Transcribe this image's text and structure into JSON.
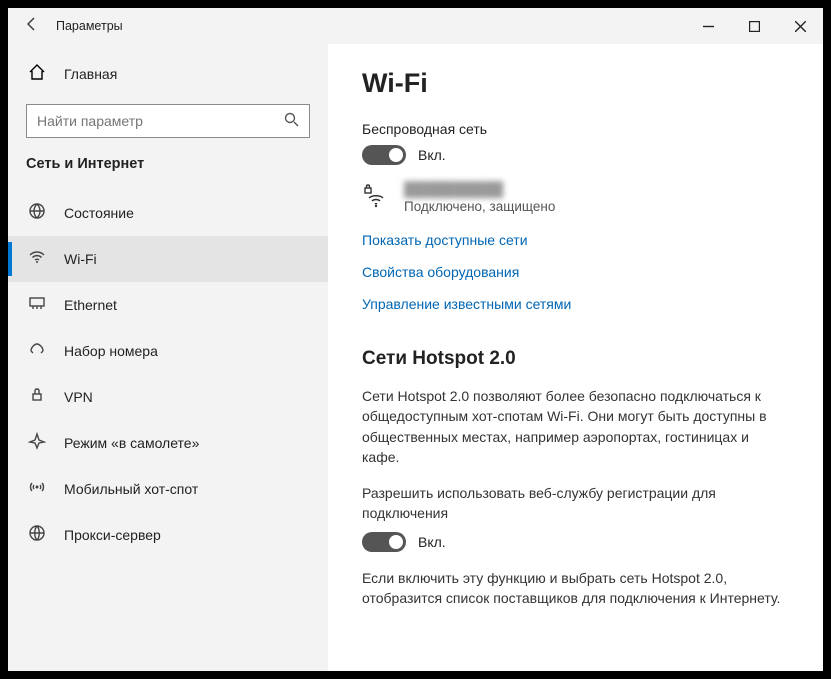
{
  "titlebar": {
    "title": "Параметры"
  },
  "sidebar": {
    "home_label": "Главная",
    "search_placeholder": "Найти параметр",
    "section_title": "Сеть и Интернет",
    "items": [
      {
        "label": "Состояние"
      },
      {
        "label": "Wi-Fi"
      },
      {
        "label": "Ethernet"
      },
      {
        "label": "Набор номера"
      },
      {
        "label": "VPN"
      },
      {
        "label": "Режим «в самолете»"
      },
      {
        "label": "Мобильный хот-спот"
      },
      {
        "label": "Прокси-сервер"
      }
    ]
  },
  "main": {
    "heading": "Wi-Fi",
    "wireless_label": "Беспроводная сеть",
    "toggle1_state": "Вкл.",
    "conn": {
      "ssid_hidden": "██████████",
      "status": "Подключено, защищено"
    },
    "link_available": "Показать доступные сети",
    "link_hw": "Свойства оборудования",
    "link_known": "Управление известными сетями",
    "hotspot_heading": "Сети Hotspot 2.0",
    "hotspot_desc": "Сети Hotspot 2.0 позволяют более безопасно подключаться к общедоступным хот-спотам Wi-Fi. Они могут быть доступны в общественных местах, например аэропортах, гостиницах и кафе.",
    "reg_label": "Разрешить использовать веб-службу регистрации для подключения",
    "toggle2_state": "Вкл.",
    "reg_desc": "Если включить эту функцию и выбрать сеть Hotspot 2.0, отобразится список поставщиков для подключения к Интернету."
  }
}
